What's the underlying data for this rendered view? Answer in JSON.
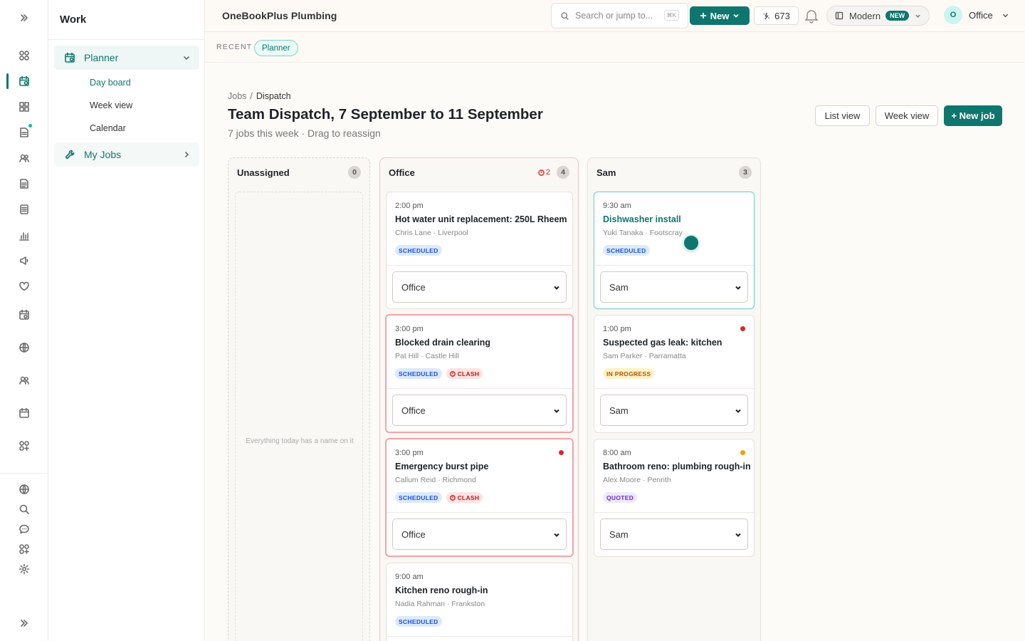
{
  "app": {
    "company": "OneBookPlus Plumbing"
  },
  "sidebar": {
    "title": "Work",
    "groups": [
      {
        "label": "Planner",
        "icon": "calendar-icon",
        "expanded": true
      },
      {
        "label": "My Jobs",
        "icon": "wrench-icon",
        "expanded": false
      }
    ],
    "planner_items": [
      {
        "label": "Day board",
        "active": true
      },
      {
        "label": "Week view",
        "active": false
      },
      {
        "label": "Calendar",
        "active": false
      }
    ]
  },
  "rail": {
    "icons": [
      "expand-icon",
      "dashboard-icon",
      "calendar-icon",
      "grid-icon",
      "document-icon",
      "users-icon",
      "file-icon",
      "list-icon",
      "chart-icon",
      "megaphone-icon",
      "heart-icon",
      "calendar-alt-icon",
      "globe-icon",
      "team-icon",
      "schedule-icon",
      "apps-icon",
      "globe-icon",
      "search-icon",
      "chat-icon",
      "apps-alt-icon",
      "settings-icon",
      "collapse-icon"
    ]
  },
  "topbar": {
    "search_placeholder": "Search or jump to...",
    "shortcut": "⌘K",
    "new_label": "New",
    "credits": "673",
    "mode_label": "Modern",
    "mode_badge": "NEW",
    "user_initial": "O",
    "user_name": "Office"
  },
  "recent": {
    "label": "RECENT",
    "chips": [
      "Planner"
    ]
  },
  "page": {
    "breadcrumb": [
      "Jobs",
      "Dispatch"
    ],
    "title": "Team Dispatch, 7 September to 11 September",
    "subtitle": "7 jobs this week · Drag to reassign",
    "buttons": {
      "list_view": "List view",
      "week_view": "Week view",
      "new_job": "+ New job"
    }
  },
  "columns": {
    "unassigned": {
      "name": "Unassigned",
      "count": "0",
      "empty_text": "Everything today has a name on it"
    },
    "office": {
      "name": "Office",
      "clash_count": "2",
      "count": "4",
      "jobs": [
        {
          "time": "2:00 pm",
          "title": "Hot water unit replacement: 250L Rheem",
          "meta": "Chris Lane · Liverpool",
          "status": "SCHEDULED",
          "clash": false,
          "assignee": "Office"
        },
        {
          "time": "3:00 pm",
          "title": "Blocked drain clearing",
          "meta": "Pat Hill · Castle Hill",
          "status": "SCHEDULED",
          "clash": true,
          "clash_label": "CLASH",
          "assignee": "Office"
        },
        {
          "time": "3:00 pm",
          "title": "Emergency burst pipe",
          "meta": "Callum Reid · Richmond",
          "status": "SCHEDULED",
          "clash": true,
          "clash_label": "CLASH",
          "assignee": "Office",
          "dot_color": "#dc2626"
        },
        {
          "time": "9:00 am",
          "title": "Kitchen reno rough-in",
          "meta": "Nadia Rahman · Frankston",
          "status": "SCHEDULED",
          "clash": false
        }
      ]
    },
    "sam": {
      "name": "Sam",
      "count": "3",
      "jobs": [
        {
          "time": "9:30 am",
          "title": "Dishwasher install",
          "meta": "Yuki Tanaka · Footscray",
          "status": "SCHEDULED",
          "assignee": "Sam"
        },
        {
          "time": "1:00 pm",
          "title": "Suspected gas leak: kitchen",
          "meta": "Sam Parker · Parramatta",
          "status": "IN PROGRESS",
          "assignee": "Sam",
          "dot_color": "#dc2626"
        },
        {
          "time": "8:00 am",
          "title": "Bathroom reno: plumbing rough-in",
          "meta": "Alex Moore · Penrith",
          "status": "QUOTED",
          "assignee": "Sam",
          "dot_color": "#f59e0b"
        }
      ]
    }
  },
  "assign_options": [
    "Office",
    "Sam"
  ],
  "colors": {
    "accent": "#0f766e",
    "clash": "#dc2626",
    "warning": "#f59e0b"
  }
}
